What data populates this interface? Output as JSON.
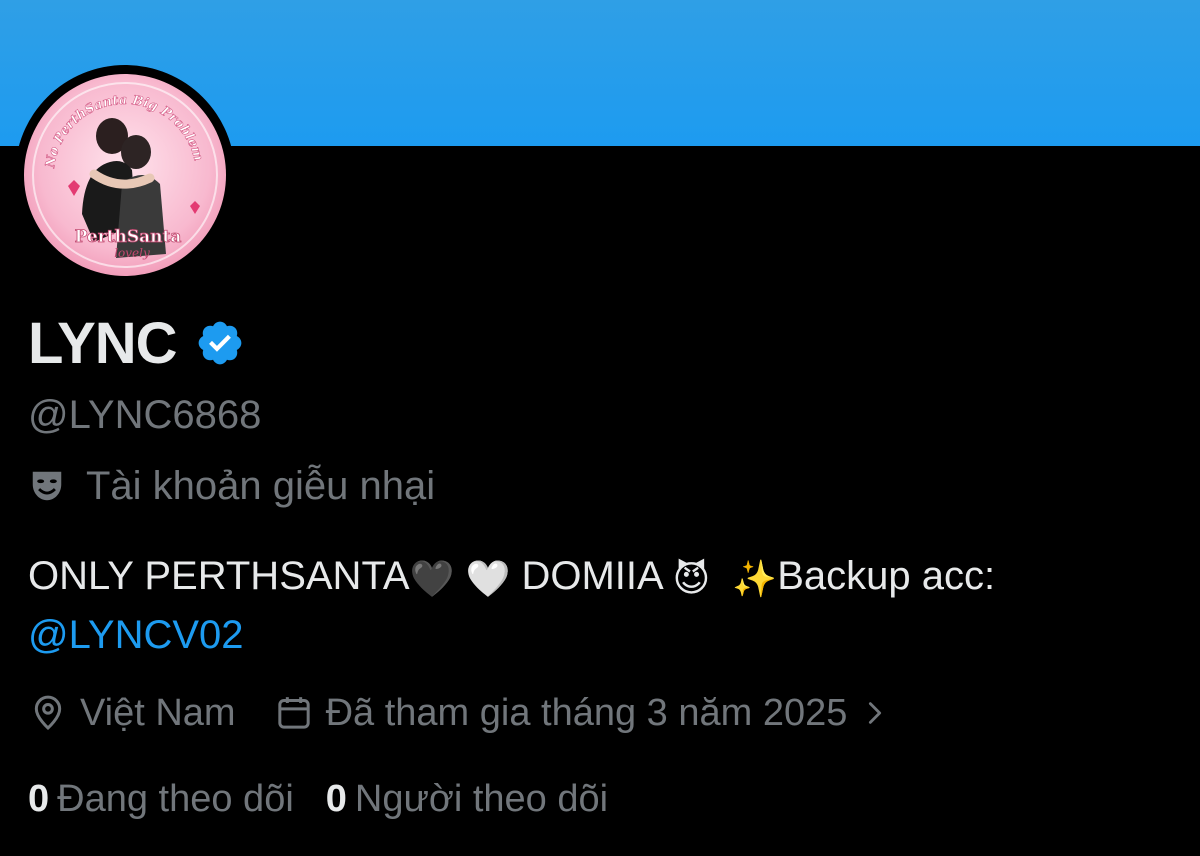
{
  "profile": {
    "display_name": "LYNC",
    "handle": "@LYNC6868",
    "parody_label": "Tài khoản giễu nhại",
    "bio": {
      "text_1": "ONLY PERTHSANTA",
      "emoji_1": "🖤",
      "emoji_2": "🤍",
      "text_2": " DOMIIA ",
      "emoji_3": "😈",
      "emoji_4": "✨",
      "text_3": "Backup acc:",
      "mention": "@LYNCV02"
    },
    "location": "Việt Nam",
    "joined": "Đã tham gia tháng 3 năm 2025",
    "following_count": "0",
    "following_label": "Đang theo dõi",
    "followers_count": "0",
    "followers_label": "Người theo dõi"
  },
  "avatar": {
    "text_top": "No PerthSanta Big Problem",
    "text_bottom": "PerthSanta",
    "text_script": "lovely"
  },
  "colors": {
    "banner": "#1d9bf0",
    "background": "#000000",
    "primary_text": "#e7e9ea",
    "secondary_text": "#71767b",
    "link": "#1d9bf0",
    "verified": "#1d9bf0"
  },
  "icons": {
    "verified": "verified-badge-icon",
    "parody": "theater-mask-icon",
    "location": "location-pin-icon",
    "joined": "calendar-icon",
    "chevron": "chevron-right-icon"
  }
}
